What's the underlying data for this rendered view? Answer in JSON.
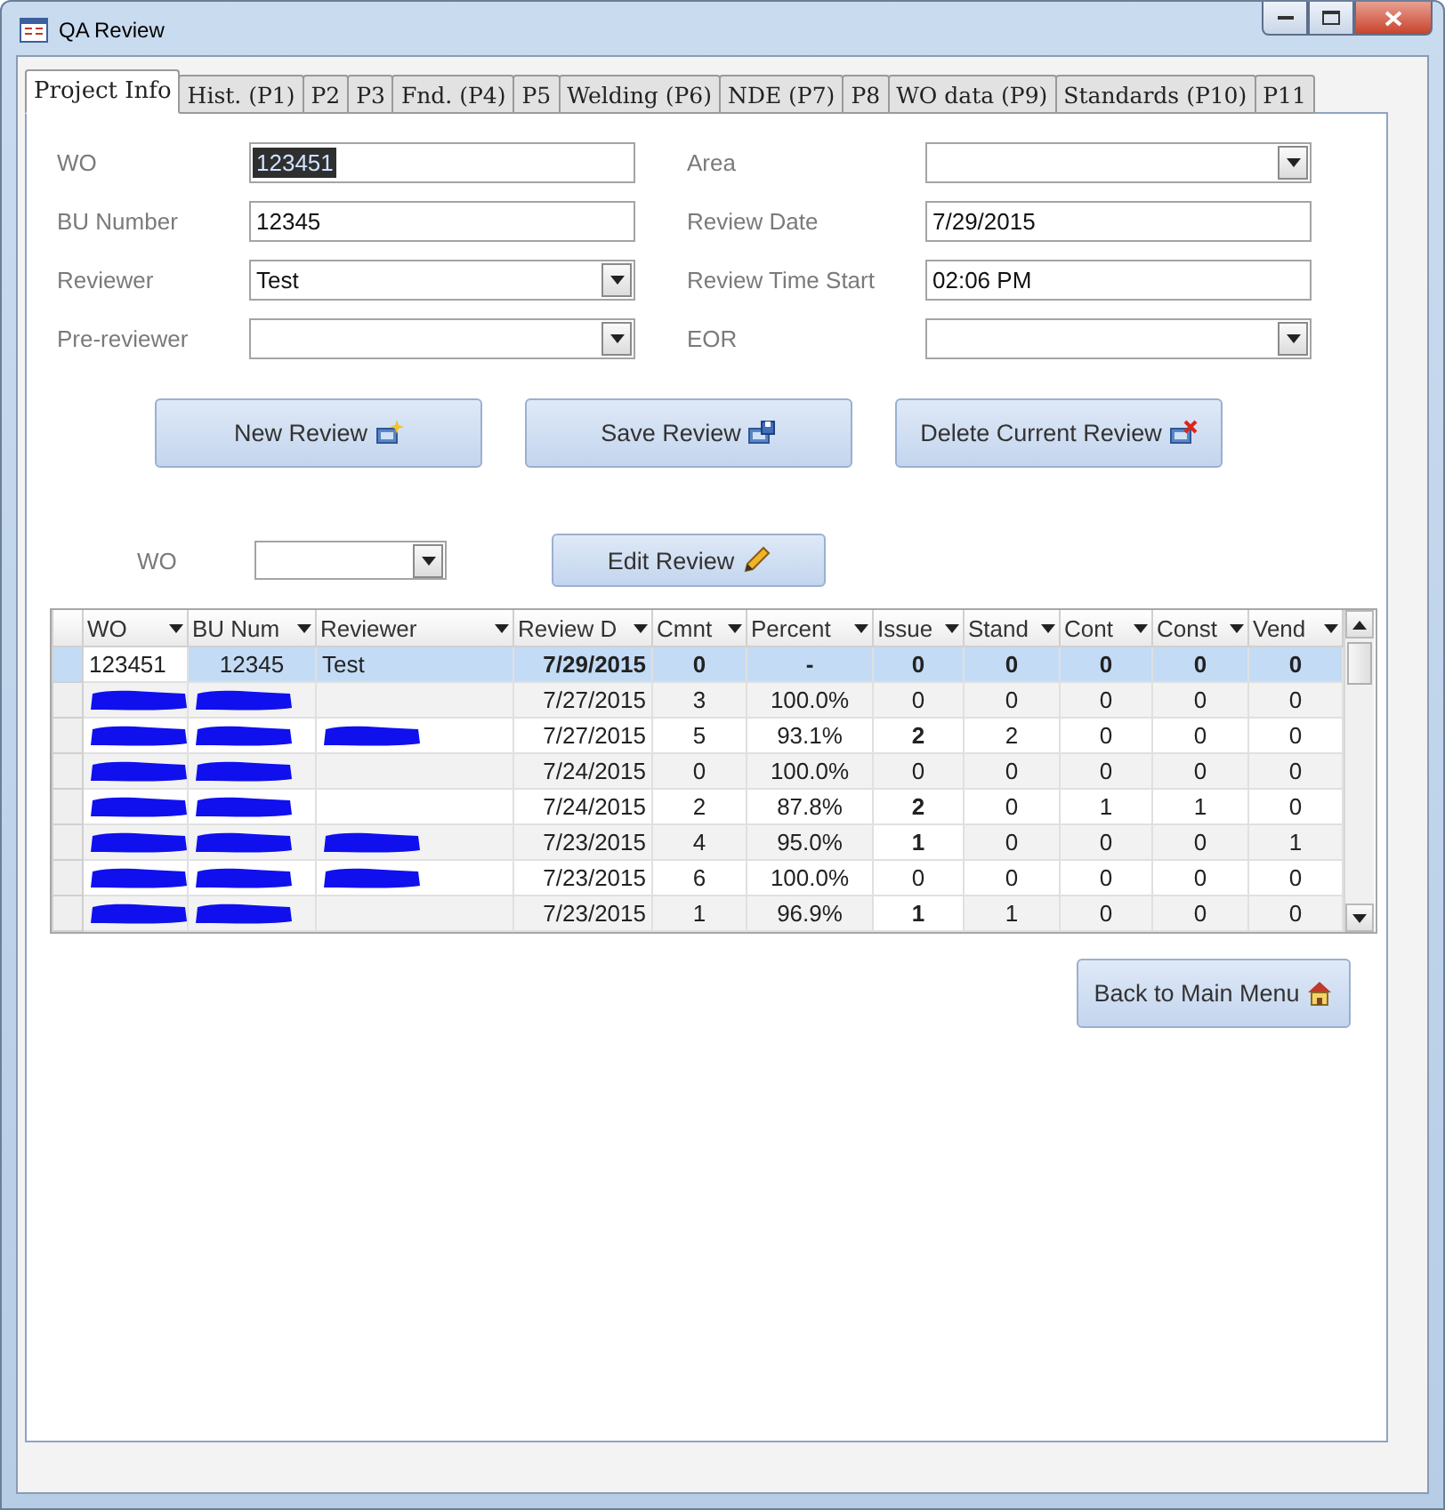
{
  "window": {
    "title": "QA Review"
  },
  "tabs": [
    {
      "label": "Project Info",
      "selected": true
    },
    {
      "label": "Hist. (P1)",
      "selected": false
    },
    {
      "label": "P2",
      "selected": false
    },
    {
      "label": "P3",
      "selected": false
    },
    {
      "label": "Fnd. (P4)",
      "selected": false
    },
    {
      "label": "P5",
      "selected": false
    },
    {
      "label": "Welding (P6)",
      "selected": false
    },
    {
      "label": "NDE (P7)",
      "selected": false
    },
    {
      "label": "P8",
      "selected": false
    },
    {
      "label": "WO data (P9)",
      "selected": false
    },
    {
      "label": "Standards (P10)",
      "selected": false
    },
    {
      "label": "P11",
      "selected": false
    }
  ],
  "form_left": [
    {
      "label": "WO",
      "kind": "text",
      "value": "123451",
      "highlighted": true
    },
    {
      "label": "BU Number",
      "kind": "text",
      "value": "12345",
      "highlighted": false
    },
    {
      "label": "Reviewer",
      "kind": "combo",
      "value": "Test",
      "highlighted": false
    },
    {
      "label": "Pre-reviewer",
      "kind": "combo"
    }
  ],
  "form_right": [
    {
      "label": "Area",
      "kind": "combo"
    },
    {
      "label": "Review Date",
      "kind": "text",
      "value": "7/29/2015",
      "highlighted": false
    },
    {
      "label": "Review Time Start",
      "kind": "text",
      "value": "02:06 PM",
      "highlighted": false
    },
    {
      "label": "EOR",
      "kind": "combo"
    }
  ],
  "actions": [
    {
      "label": "New Review",
      "kind": "new"
    },
    {
      "label": "Save Review",
      "kind": "save"
    },
    {
      "label": "Delete Current Review",
      "kind": "delete"
    }
  ],
  "filter": {
    "label": "WO",
    "button": "Edit Review"
  },
  "table": {
    "columns": [
      "WO",
      "BU Num",
      "Reviewer",
      "Review D",
      "Cmnt",
      "Percent",
      "Issue",
      "Stand",
      "Cont",
      "Const",
      "Vend"
    ],
    "rows": [
      {
        "selected": true,
        "cells": [
          {
            "kind": "text",
            "text": "123451"
          },
          {
            "kind": "text",
            "text": "12345"
          },
          {
            "kind": "text",
            "text": "Test"
          },
          {
            "kind": "text",
            "text": "7/29/2015",
            "bold": true
          },
          {
            "kind": "text",
            "text": "0",
            "bold": true
          },
          {
            "kind": "text",
            "text": "-",
            "bold": true
          },
          {
            "kind": "text",
            "text": "0",
            "bold": true
          },
          {
            "kind": "text",
            "text": "0",
            "bold": true
          },
          {
            "kind": "text",
            "text": "0",
            "bold": true
          },
          {
            "kind": "text",
            "text": "0",
            "bold": true
          },
          {
            "kind": "text",
            "text": "0",
            "bold": true
          }
        ]
      },
      {
        "selected": false,
        "cells": [
          {
            "kind": "redacted"
          },
          {
            "kind": "redacted"
          },
          {
            "kind": "blank"
          },
          {
            "kind": "text",
            "text": "7/27/2015"
          },
          {
            "kind": "text",
            "text": "3"
          },
          {
            "kind": "text",
            "text": "100.0%"
          },
          {
            "kind": "text",
            "text": "0"
          },
          {
            "kind": "text",
            "text": "0"
          },
          {
            "kind": "text",
            "text": "0"
          },
          {
            "kind": "text",
            "text": "0"
          },
          {
            "kind": "text",
            "text": "0"
          }
        ]
      },
      {
        "selected": false,
        "cells": [
          {
            "kind": "redacted"
          },
          {
            "kind": "redacted"
          },
          {
            "kind": "redacted"
          },
          {
            "kind": "text",
            "text": "7/27/2015"
          },
          {
            "kind": "text",
            "text": "5"
          },
          {
            "kind": "text",
            "text": "93.1%"
          },
          {
            "kind": "text",
            "text": "2",
            "bold": true
          },
          {
            "kind": "text",
            "text": "2"
          },
          {
            "kind": "text",
            "text": "0"
          },
          {
            "kind": "text",
            "text": "0"
          },
          {
            "kind": "text",
            "text": "0"
          }
        ]
      },
      {
        "selected": false,
        "cells": [
          {
            "kind": "redacted"
          },
          {
            "kind": "redacted"
          },
          {
            "kind": "blank"
          },
          {
            "kind": "text",
            "text": "7/24/2015"
          },
          {
            "kind": "text",
            "text": "0"
          },
          {
            "kind": "text",
            "text": "100.0%"
          },
          {
            "kind": "text",
            "text": "0"
          },
          {
            "kind": "text",
            "text": "0"
          },
          {
            "kind": "text",
            "text": "0"
          },
          {
            "kind": "text",
            "text": "0"
          },
          {
            "kind": "text",
            "text": "0"
          }
        ]
      },
      {
        "selected": false,
        "cells": [
          {
            "kind": "redacted"
          },
          {
            "kind": "redacted"
          },
          {
            "kind": "blank"
          },
          {
            "kind": "text",
            "text": "7/24/2015"
          },
          {
            "kind": "text",
            "text": "2"
          },
          {
            "kind": "text",
            "text": "87.8%"
          },
          {
            "kind": "text",
            "text": "2",
            "bold": true
          },
          {
            "kind": "text",
            "text": "0"
          },
          {
            "kind": "text",
            "text": "1"
          },
          {
            "kind": "text",
            "text": "1"
          },
          {
            "kind": "text",
            "text": "0"
          }
        ]
      },
      {
        "selected": false,
        "cells": [
          {
            "kind": "redacted"
          },
          {
            "kind": "redacted"
          },
          {
            "kind": "redacted"
          },
          {
            "kind": "text",
            "text": "7/23/2015"
          },
          {
            "kind": "text",
            "text": "4"
          },
          {
            "kind": "text",
            "text": "95.0%"
          },
          {
            "kind": "text",
            "text": "1",
            "bold": true
          },
          {
            "kind": "text",
            "text": "0"
          },
          {
            "kind": "text",
            "text": "0"
          },
          {
            "kind": "text",
            "text": "0"
          },
          {
            "kind": "text",
            "text": "1"
          }
        ]
      },
      {
        "selected": false,
        "cells": [
          {
            "kind": "redacted"
          },
          {
            "kind": "redacted"
          },
          {
            "kind": "redacted"
          },
          {
            "kind": "text",
            "text": "7/23/2015"
          },
          {
            "kind": "text",
            "text": "6"
          },
          {
            "kind": "text",
            "text": "100.0%"
          },
          {
            "kind": "text",
            "text": "0"
          },
          {
            "kind": "text",
            "text": "0"
          },
          {
            "kind": "text",
            "text": "0"
          },
          {
            "kind": "text",
            "text": "0"
          },
          {
            "kind": "text",
            "text": "0"
          }
        ]
      },
      {
        "selected": false,
        "cells": [
          {
            "kind": "redacted"
          },
          {
            "kind": "redacted"
          },
          {
            "kind": "blank"
          },
          {
            "kind": "text",
            "text": "7/23/2015"
          },
          {
            "kind": "text",
            "text": "1"
          },
          {
            "kind": "text",
            "text": "96.9%"
          },
          {
            "kind": "text",
            "text": "1",
            "bold": true
          },
          {
            "kind": "text",
            "text": "1"
          },
          {
            "kind": "text",
            "text": "0"
          },
          {
            "kind": "text",
            "text": "0"
          },
          {
            "kind": "text",
            "text": "0"
          }
        ]
      }
    ]
  },
  "back_button": {
    "label": "Back to Main Menu"
  }
}
